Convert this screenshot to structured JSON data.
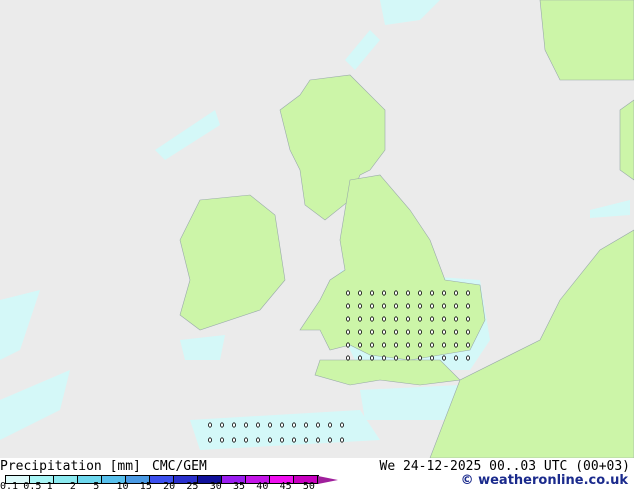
{
  "title": "Precipitation [mm]",
  "model": "CMC/GEM",
  "valid_time": "We 24-12-2025 00..03 UTC (00+03)",
  "copyright": "© weatheronline.co.uk",
  "legend": {
    "ticks": [
      "0.1",
      "0.5",
      "1",
      "2",
      "5",
      "10",
      "15",
      "20",
      "25",
      "30",
      "35",
      "40",
      "45",
      "50"
    ],
    "colors": [
      "#dcfafa",
      "#a8f5f5",
      "#8ceaf0",
      "#6ed8ee",
      "#58c0ec",
      "#4a9ae4",
      "#3c50ee",
      "#2a30cc",
      "#10109a",
      "#9a1ef0",
      "#c416e8",
      "#f010f0",
      "#c800c0",
      "#a0209c"
    ]
  },
  "colors": {
    "sea": "#ebebeb",
    "land": "#ccf5a8",
    "precip": "#d4f8f8"
  }
}
